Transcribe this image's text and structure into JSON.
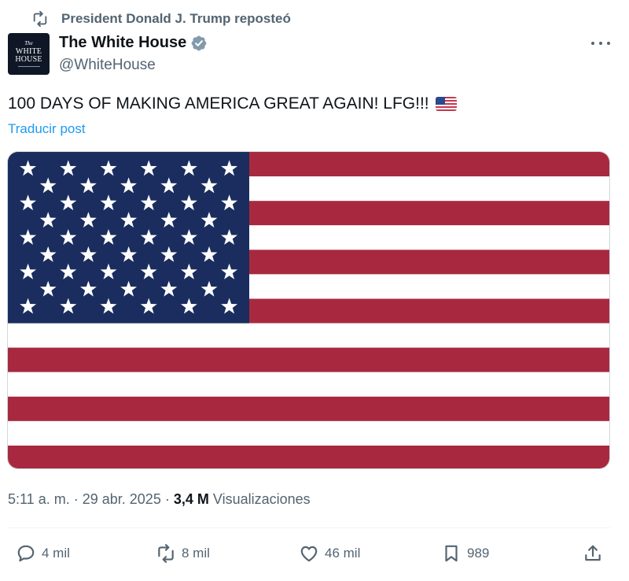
{
  "repost_banner": {
    "text": "President Donald J. Trump reposteó",
    "icon": "repost-icon"
  },
  "author": {
    "name": "The White House",
    "handle": "@WhiteHouse",
    "verified_icon": "verified-badge-icon",
    "avatar": {
      "line1": "The",
      "line2": "WHITE",
      "line3": "HOUSE"
    }
  },
  "menu_icon": "more-options-icon",
  "post": {
    "text": "100 DAYS OF MAKING AMERICA GREAT AGAIN! LFG!!!",
    "emoji": "us-flag-emoji",
    "translate_label": "Traducir post"
  },
  "media": {
    "type": "image",
    "subject": "us-flag-image"
  },
  "meta": {
    "time": "5:11 a. m.",
    "date": "29 abr. 2025",
    "views_count": "3,4 M",
    "views_label": "Visualizaciones"
  },
  "actions": {
    "replies": "4 mil",
    "reposts": "8 mil",
    "likes": "46 mil",
    "bookmarks": "989"
  },
  "colors": {
    "accent": "#1d9bf0",
    "secondary_text": "#536471",
    "flag_red": "#a8293f",
    "flag_blue": "#1a2d5e",
    "verified": "#829aab"
  }
}
